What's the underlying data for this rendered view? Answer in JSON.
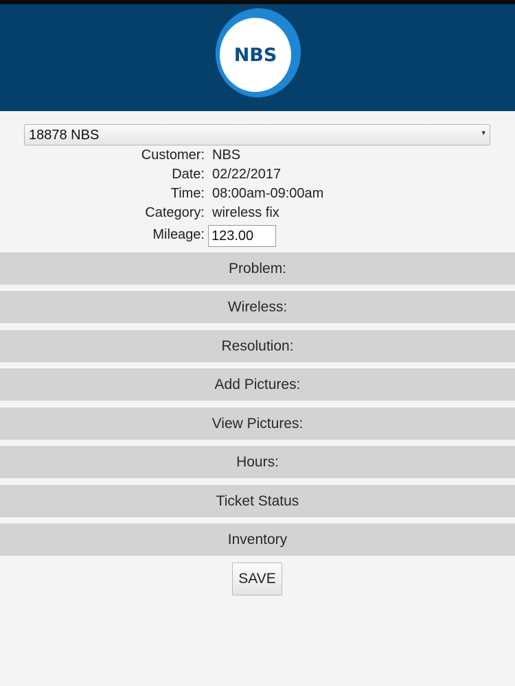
{
  "header": {
    "logo_text": "NBS"
  },
  "ticket_select": {
    "selected": "18878 NBS"
  },
  "details": [
    {
      "label": "Customer:",
      "value": "NBS"
    },
    {
      "label": "Date:",
      "value": "02/22/2017"
    },
    {
      "label": "Time:",
      "value": "08:00am-09:00am"
    },
    {
      "label": "Category:",
      "value": "wireless fix"
    }
  ],
  "mileage": {
    "label": "Mileage:",
    "value": "123.00"
  },
  "sections": [
    "Problem:",
    "Wireless:",
    "Resolution:",
    "Add Pictures:",
    "View Pictures:",
    "Hours:",
    "Ticket Status",
    "Inventory"
  ],
  "save_label": "SAVE",
  "colors": {
    "header_bg": "#05406b",
    "logo_ring": "#1f86d4",
    "logo_text": "#0d4e86",
    "section_bg": "#d3d3d3",
    "page_bg": "#f4f4f4"
  }
}
